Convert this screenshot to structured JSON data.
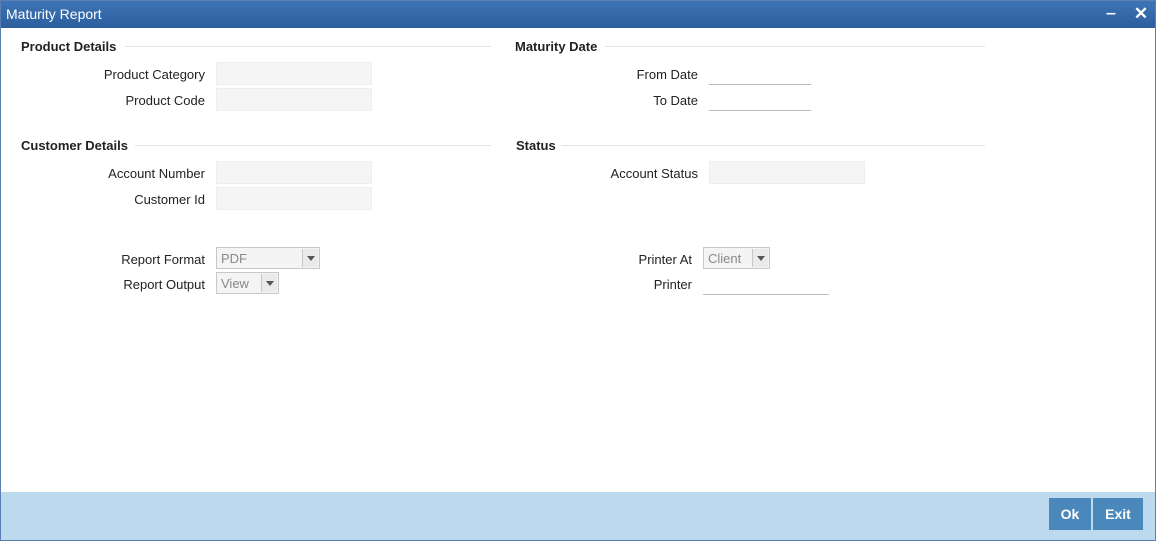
{
  "window": {
    "title": "Maturity Report",
    "minimize_glyph": "‒",
    "close_glyph": "✕"
  },
  "product_details": {
    "heading": "Product Details",
    "product_category_label": "Product Category",
    "product_category_value": "",
    "product_code_label": "Product Code",
    "product_code_value": ""
  },
  "maturity_date": {
    "heading": "Maturity Date",
    "from_date_label": "From Date",
    "from_date_value": "",
    "to_date_label": "To Date",
    "to_date_value": ""
  },
  "customer_details": {
    "heading": "Customer Details",
    "account_number_label": "Account Number",
    "account_number_value": "",
    "customer_id_label": "Customer Id",
    "customer_id_value": ""
  },
  "status": {
    "heading": "Status",
    "account_status_label": "Account Status",
    "account_status_value": ""
  },
  "report": {
    "format_label": "Report Format",
    "format_value": "PDF",
    "output_label": "Report Output",
    "output_value": "View",
    "printer_at_label": "Printer At",
    "printer_at_value": "Client",
    "printer_label": "Printer",
    "printer_value": ""
  },
  "footer": {
    "ok_label": "Ok",
    "exit_label": "Exit"
  },
  "colors": {
    "titlebar": "#2c5e9e",
    "footer": "#bcd9ee",
    "button": "#4a87bb"
  }
}
